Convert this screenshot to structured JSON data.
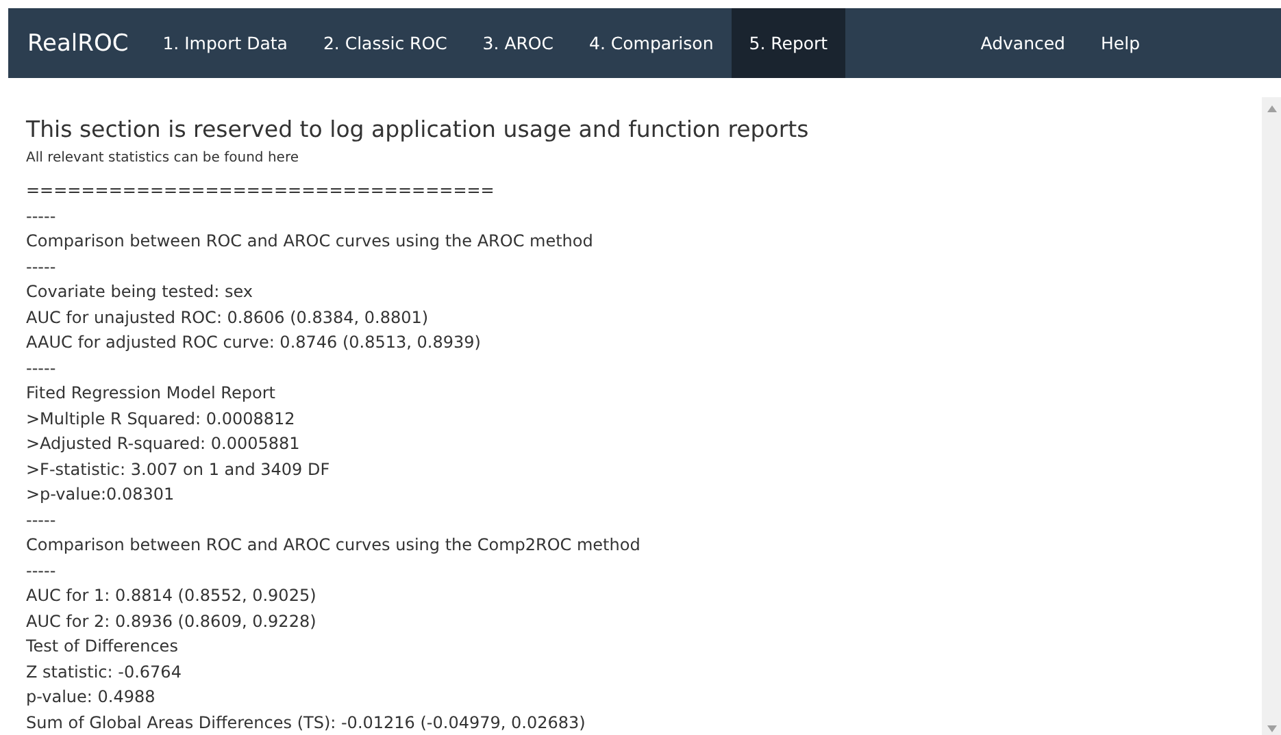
{
  "navbar": {
    "brand": "RealROC",
    "tabs": [
      {
        "label": "1. Import Data",
        "selected": false
      },
      {
        "label": "2. Classic ROC",
        "selected": false
      },
      {
        "label": "3. AROC",
        "selected": false
      },
      {
        "label": "4. Comparison",
        "selected": false
      },
      {
        "label": "5. Report",
        "selected": true
      }
    ],
    "right_items": [
      "Advanced",
      "Help"
    ]
  },
  "report": {
    "title": "This section is reserved to log application usage and function reports",
    "subtitle": "All relevant statistics can be found here",
    "log_lines": [
      "==================================",
      "-----",
      "Comparison between ROC and AROC curves using the AROC method",
      "-----",
      "Covariate being tested: sex",
      "AUC for unajusted ROC: 0.8606 (0.8384, 0.8801)",
      "AAUC for adjusted ROC curve: 0.8746 (0.8513, 0.8939)",
      "-----",
      "Fited Regression Model Report",
      ">Multiple R Squared: 0.0008812",
      ">Adjusted R-squared: 0.0005881",
      ">F-statistic: 3.007 on 1 and 3409 DF",
      ">p-value:0.08301",
      "-----",
      "Comparison between ROC and AROC curves using the Comp2ROC method",
      "-----",
      "AUC for 1: 0.8814 (0.8552, 0.9025)",
      "AUC for 2: 0.8936 (0.8609, 0.9228)",
      "Test of Differences",
      "Z statistic: -0.6764",
      "p-value: 0.4988",
      "Sum of Global Areas Differences (TS): -0.01216 (-0.04979, 0.02683)"
    ]
  }
}
